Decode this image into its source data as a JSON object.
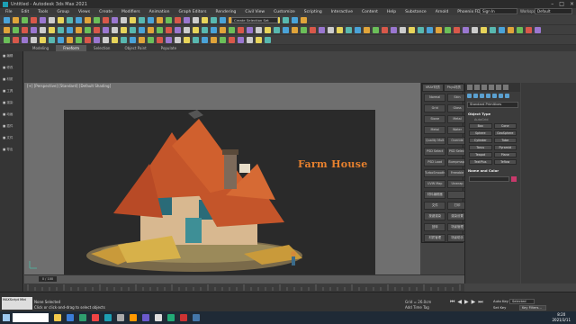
{
  "window": {
    "title": "Untitled - Autodesk 3ds Max 2021"
  },
  "menu": [
    "File",
    "Edit",
    "Tools",
    "Group",
    "Views",
    "Create",
    "Modifiers",
    "Animation",
    "Graph Editors",
    "Rendering",
    "Civil View",
    "Customize",
    "Scripting",
    "Interactive",
    "Content",
    "Help",
    "Substance",
    "Arnold",
    "Phoenix FD"
  ],
  "account": {
    "signin": "Sign In",
    "workspaces_label": "Workspaces:",
    "workspace": "Default"
  },
  "toolbar": {
    "create_selection_set": "Create Selection Set"
  },
  "ribbon": {
    "tabs": [
      "Modeling",
      "Freeform",
      "Selection",
      "Object Paint",
      "Populate"
    ],
    "active": "Freeform"
  },
  "viewport": {
    "label": "[+] [Perspective] [Standard] [Default Shading]",
    "render_title": "Farm House"
  },
  "plugin_panel": {
    "header": [
      "VRAY材质",
      "Phys材质"
    ],
    "buttons": [
      "Normal",
      "Skin",
      "Grid",
      "Glass",
      "Stone",
      "Metal",
      "Metal",
      "Water",
      "Quality Mult",
      "Overide",
      "PSD Select",
      "PSD Select",
      "PSD Load",
      "Bumpmaps",
      "TurboSmooth",
      "Freeable",
      "UVW Map",
      "Unwrap",
      "材料编辑器",
      "",
      "文件",
      "打印",
      "按键渲染",
      "渲染设置",
      "回转",
      "场景管理",
      "材质管理",
      "场景助手"
    ]
  },
  "command_panel": {
    "dropdown": "Standard Primitives",
    "object_type": "Object Type",
    "autogrid": "AutoGrid",
    "objects": [
      "Box",
      "Cone",
      "Sphere",
      "GeoSphere",
      "Cylinder",
      "Tube",
      "Torus",
      "Pyramid",
      "Teapot",
      "Plane",
      "TextPlus",
      "Teflow"
    ],
    "name_color": "Name and Color"
  },
  "timeline": {
    "frame": "0 / 100"
  },
  "status": {
    "selected": "None Selected",
    "prompt": "Click or click-and-drag to select objects",
    "grid": "Grid = 26.0cm",
    "add_time_tag": "Add Time Tag",
    "auto_key": "Auto Key",
    "selected_drop": "Selected",
    "set_key": "Set Key",
    "key_filters": "Key Filters..."
  },
  "maxscript": "MAXScript Mini",
  "taskbar": {
    "search": "",
    "time": "8:20",
    "date": "2021/3/11"
  },
  "colors": {
    "accent": "#e8812e",
    "bg": "#444444"
  }
}
